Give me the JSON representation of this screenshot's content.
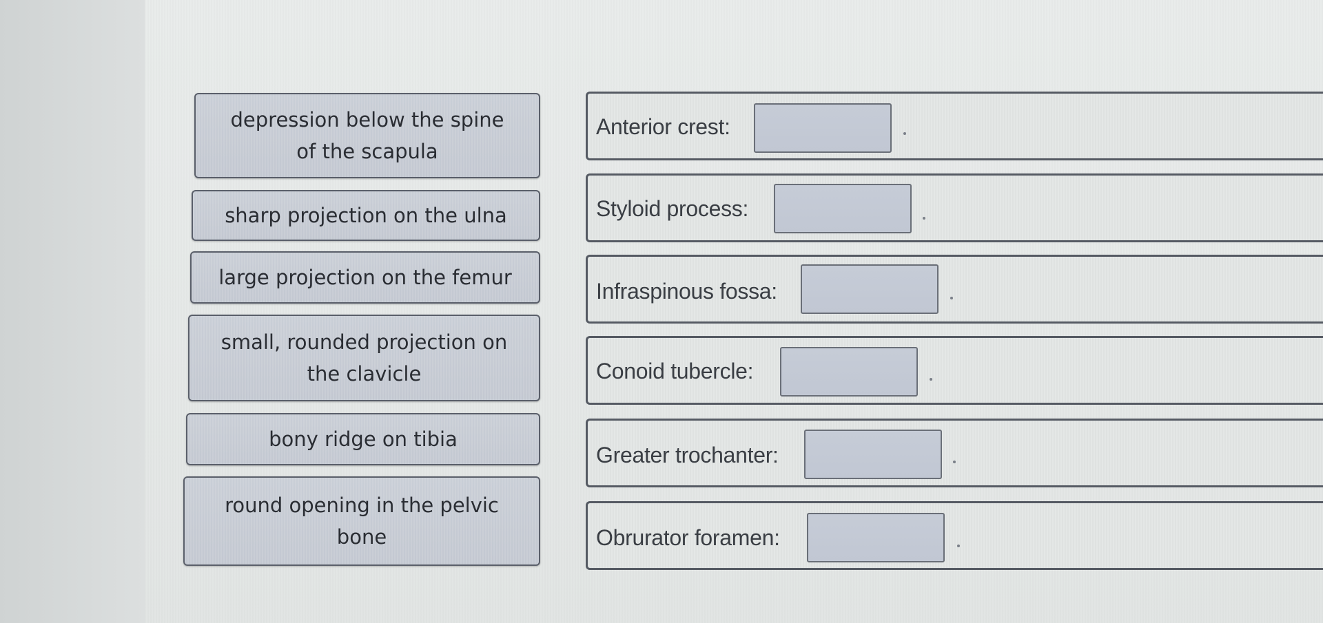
{
  "options": [
    {
      "lines": [
        "depression below the spine",
        "of the scapula"
      ]
    },
    {
      "lines": [
        "sharp projection on the ulna"
      ]
    },
    {
      "lines": [
        "large projection on the femur"
      ]
    },
    {
      "lines": [
        "small, rounded projection on",
        "the clavicle"
      ]
    },
    {
      "lines": [
        "bony ridge on tibia"
      ]
    },
    {
      "lines": [
        "round opening in the pelvic",
        "bone"
      ]
    }
  ],
  "targets": [
    {
      "label": "Anterior crest:"
    },
    {
      "label": "Styloid process:"
    },
    {
      "label": "Infraspinous fossa:"
    },
    {
      "label": "Conoid tubercle:"
    },
    {
      "label": "Greater trochanter:"
    },
    {
      "label": "Obrurator foramen:"
    }
  ]
}
